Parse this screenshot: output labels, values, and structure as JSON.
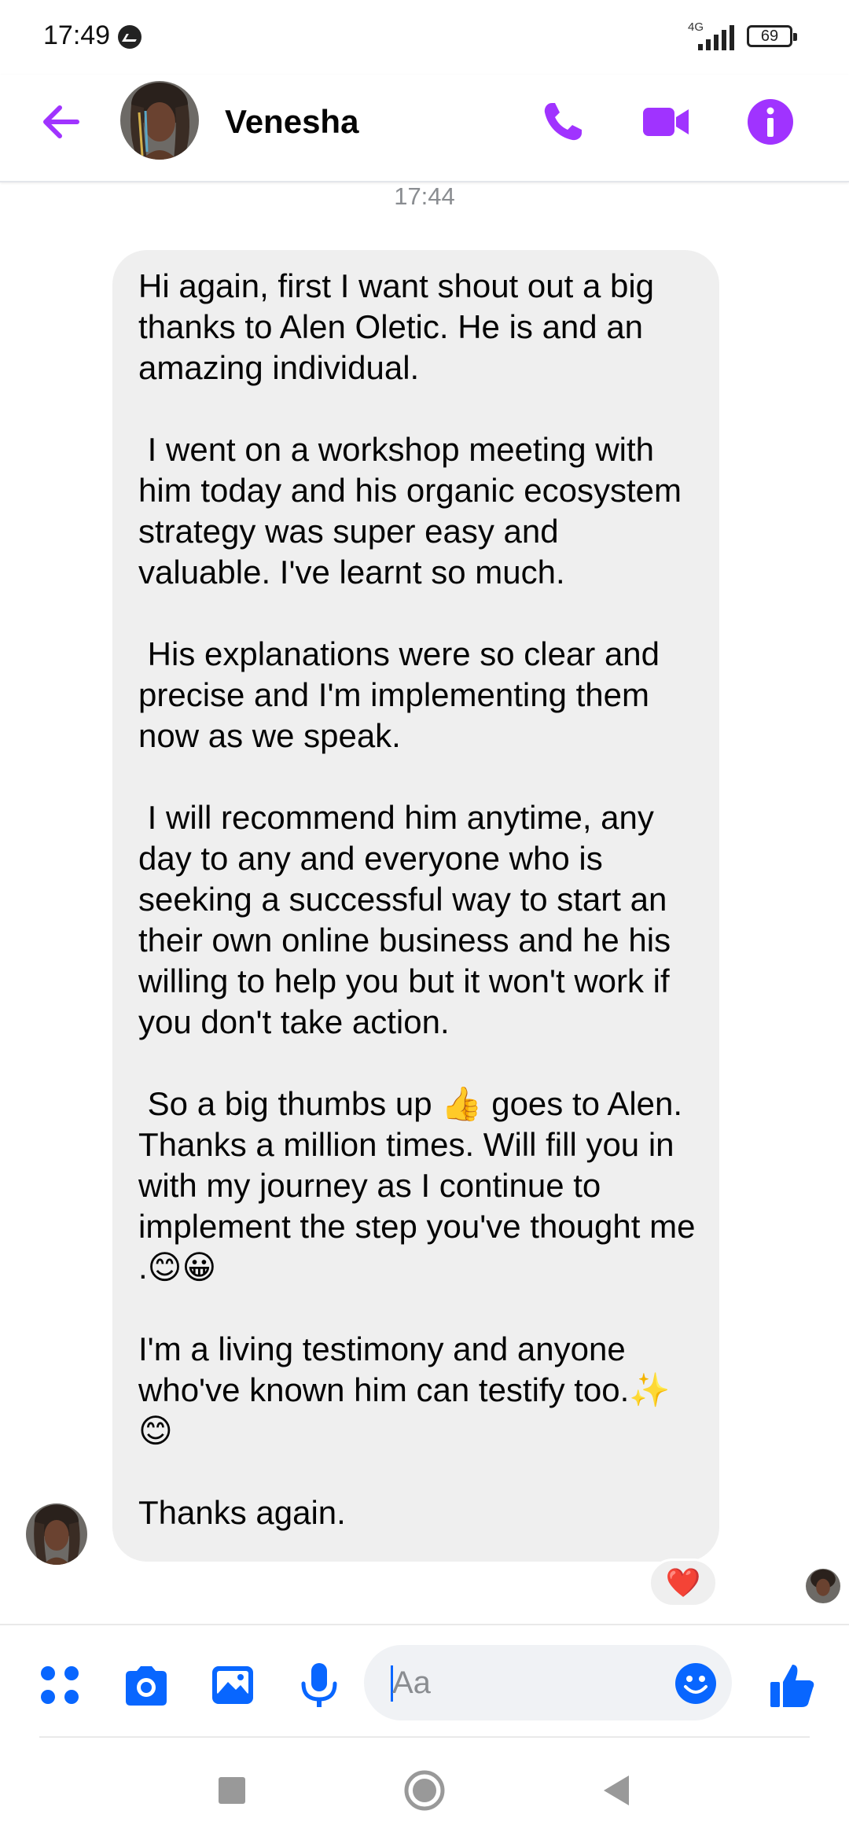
{
  "status_bar": {
    "time": "17:49",
    "network": "4G",
    "battery": "69"
  },
  "header": {
    "contact_name": "Venesha",
    "accent_color": "#a033ff"
  },
  "thread": {
    "timestamp": "17:44",
    "message_paragraphs": [
      "Hi again, first I want shout out a big thanks to Alen Oletic. He is and an amazing individual.",
      " I went on a workshop meeting with him today and his organic ecosystem strategy was super easy and valuable. I've learnt so much.",
      " His explanations were so clear and precise and I'm implementing them now as we speak.",
      " I will recommend him anytime, any day to any and everyone who is seeking a successful way to start an their own online business and he his willing to help you but it won't work if you don't take action.",
      " So a big thumbs up 👍 goes to Alen. Thanks a million times. Will fill you in with my journey as I continue to implement the step you've thought me .😊😀",
      "I'm a living testimony and anyone who've known him can testify too.✨ 😊",
      "Thanks again."
    ],
    "reaction": "❤️"
  },
  "composer": {
    "placeholder": "Aa",
    "icon_color": "#0866ff"
  },
  "icons": [
    "back-arrow-icon",
    "phone-icon",
    "video-camera-icon",
    "info-icon",
    "apps-grid-icon",
    "camera-icon",
    "gallery-icon",
    "microphone-icon",
    "emoji-icon",
    "thumbs-up-icon",
    "nav-recents-icon",
    "nav-home-icon",
    "nav-back-icon"
  ]
}
